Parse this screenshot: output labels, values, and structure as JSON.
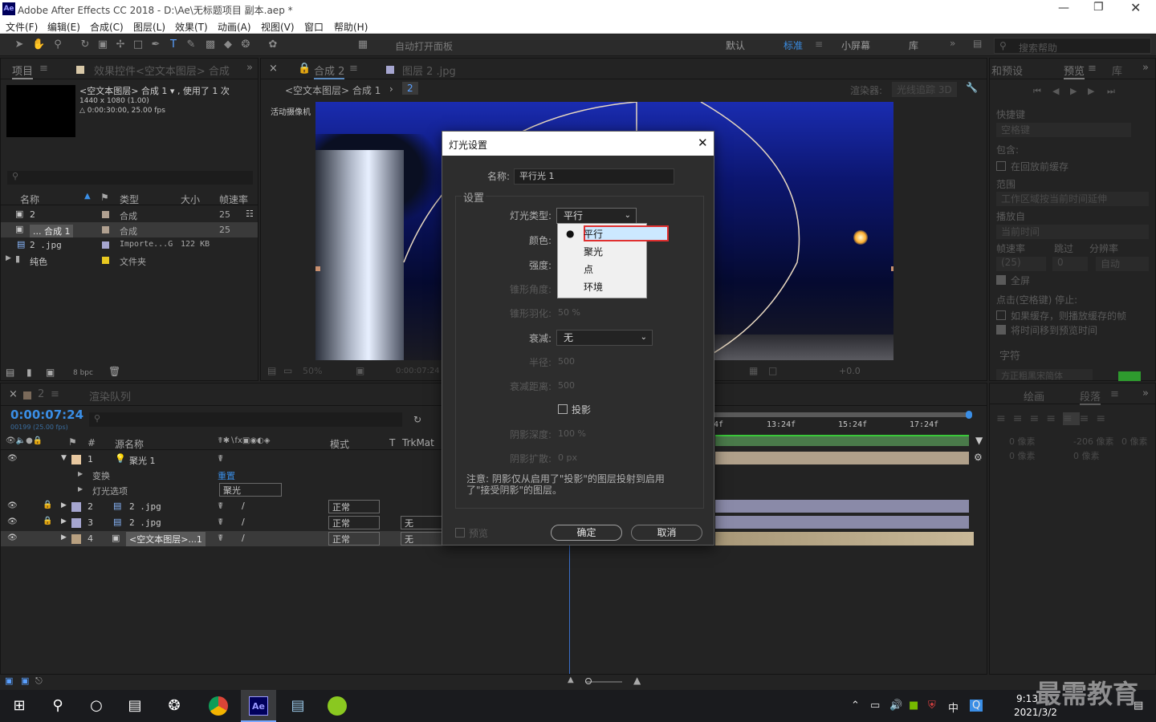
{
  "window": {
    "title": "Adobe After Effects CC 2018 - D:\\Ae\\无标题项目 副本.aep *",
    "logo": "Ae"
  },
  "menu": [
    "文件(F)",
    "编辑(E)",
    "合成(C)",
    "图层(L)",
    "效果(T)",
    "动画(A)",
    "视图(V)",
    "窗口",
    "帮助(H)"
  ],
  "toolbar": {
    "auto_open": "自动打开面板",
    "workspaces": [
      "默认",
      "标准",
      "小屏幕",
      "库"
    ],
    "search_placeholder": "搜索帮助"
  },
  "project": {
    "tab": "项目",
    "tab2": "效果控件<空文本图层> 合成",
    "comp_name": "<空文本图层> 合成 1 ▾ , 使用了 1 次",
    "dims": "1440 x 1080 (1.00)",
    "duration": "△ 0:00:30:00, 25.00 fps",
    "cols": [
      "名称",
      "类型",
      "大小",
      "帧速率"
    ],
    "rows": [
      {
        "name": "2",
        "type": "合成",
        "size": "",
        "fps": "25",
        "color": "#b0a090"
      },
      {
        "name": "... 合成 1",
        "type": "合成",
        "size": "",
        "fps": "25",
        "color": "#b0a090"
      },
      {
        "name": "2 .jpg",
        "type": "Importe...G",
        "size": "122 KB",
        "fps": "",
        "color": "#a6a6d0"
      },
      {
        "name": "纯色",
        "type": "文件夹",
        "size": "",
        "fps": "",
        "color": "#e8c820"
      }
    ],
    "bpc": "8 bpc"
  },
  "comp": {
    "tab": "合成 2",
    "tab2": "图层 2 .jpg",
    "breadcrumb": "<空文本图层> 合成 1",
    "crumb2": "2",
    "renderer_label": "渲染器:",
    "renderer": "光线追踪 3D",
    "camera": "活动摄像机",
    "zoom": "50%",
    "time": "0:00:07:24",
    "exposure": "+0.0"
  },
  "preview": {
    "tab": "预览",
    "tab2": "库",
    "shortcut_label": "快捷键",
    "shortcut": "空格键",
    "include": "包含:",
    "cache": "在回放前缓存",
    "range_label": "范围",
    "range": "工作区域按当前时间延伸",
    "playfrom_label": "播放自",
    "playfrom": "当前时间",
    "fps_label": "帧速率",
    "skip_label": "跳过",
    "res_label": "分辨率",
    "fps": "(25)",
    "skip": "0",
    "res": "自动",
    "fullscreen": "全屏",
    "stop_label": "点击(空格键) 停止:",
    "cache_opt": "如果缓存，则播放缓存的帧",
    "move_time": "将时间移到预览时间",
    "character": "字符",
    "font_hint": "方正粗黑宋简体"
  },
  "paragraph": {
    "tab1": "绘画",
    "tab2": "段落",
    "v1": "0 像素",
    "v2": "-206 像素",
    "v3": "0 像素",
    "v4": "0 像素",
    "v5": "0 像素"
  },
  "timeline": {
    "tab": "2",
    "tab2": "渲染队列",
    "timecode": "0:00:07:24",
    "frames": "00199 (25.00 fps)",
    "cols": [
      "源名称",
      "模式",
      "T",
      "TrkMat"
    ],
    "ruler": [
      "4f",
      "13:24f",
      "15:24f",
      "17:24f"
    ],
    "layers": [
      {
        "num": "1",
        "name": "聚光 1",
        "mode": "",
        "trk": "",
        "color": "#e8c8a0"
      },
      {
        "num": "2",
        "name": "2 .jpg",
        "mode": "正常",
        "trk": "",
        "color": "#a6a6d0"
      },
      {
        "num": "3",
        "name": "2 .jpg",
        "mode": "正常",
        "trk": "无",
        "color": "#a6a6d0"
      },
      {
        "num": "4",
        "name": "<空文本图层>...1",
        "mode": "正常",
        "trk": "无",
        "color": "#b8a080"
      }
    ],
    "transform": "变换",
    "reset": "重置",
    "light_options": "灯光选项",
    "light_type_val": "聚光"
  },
  "dialog": {
    "title": "灯光设置",
    "name_label": "名称:",
    "name_value": "平行光 1",
    "settings": "设置",
    "type_label": "灯光类型:",
    "type_value": "平行",
    "color_label": "颜色:",
    "intensity_label": "强度:",
    "cone_angle_label": "锥形角度:",
    "cone_feather_label": "锥形羽化:",
    "cone_feather_value": "50 %",
    "falloff_label": "衰减:",
    "falloff_value": "无",
    "radius_label": "半径:",
    "radius_value": "500",
    "falloff_dist_label": "衰减距离:",
    "falloff_dist_value": "500",
    "shadow_label": "投影",
    "shadow_depth_label": "阴影深度:",
    "shadow_depth_value": "100 %",
    "shadow_diffuse_label": "阴影扩散:",
    "shadow_diffuse_value": "0 px",
    "note": "注意: 阴影仅从启用了\"投影\"的图层投射到启用了\"接受阴影\"的图层。",
    "preview_label": "预览",
    "ok": "确定",
    "cancel": "取消",
    "options": [
      "平行",
      "聚光",
      "点",
      "环境"
    ]
  },
  "taskbar": {
    "time": "9:13",
    "date": "2021/3/2",
    "ime": "中",
    "watermark": "最需教育"
  }
}
